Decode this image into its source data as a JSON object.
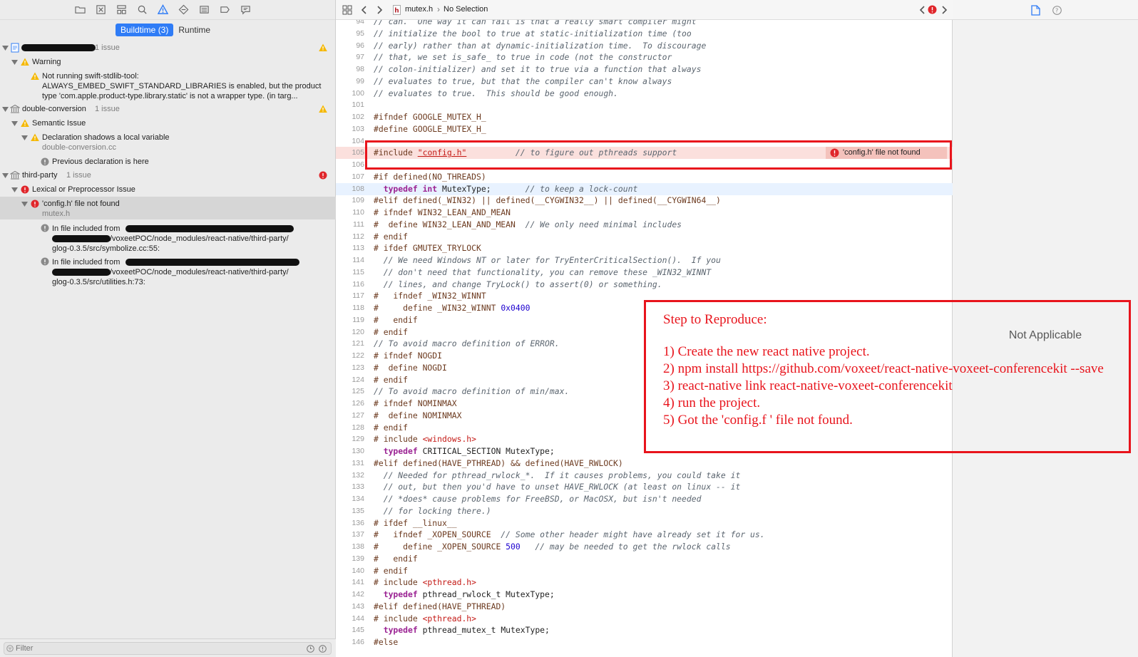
{
  "navigator": {
    "segments": {
      "buildtime": "Buildtime (3)",
      "runtime": "Runtime"
    },
    "issues": {
      "project_count": "1 issue",
      "warning_group": "Warning",
      "warning_text_1": "Not running swift-stdlib-tool:",
      "warning_text_2": "ALWAYS_EMBED_SWIFT_STANDARD_LIBRARIES is enabled, but the product",
      "warning_text_3": "type 'com.apple.product-type.library.static' is not a wrapper type. (in targ...",
      "dc_name": "double-conversion",
      "dc_count": "1 issue",
      "semantic_group": "Semantic Issue",
      "shadow_msg": "Declaration shadows a local variable",
      "shadow_file": "double-conversion.cc",
      "prev_decl": "Previous declaration is here",
      "tp_name": "third-party",
      "tp_count": "1 issue",
      "lex_group": "Lexical or Preprocessor Issue",
      "config_msg": "'config.h' file not found",
      "config_file": "mutex.h",
      "incl1_a": "In file included from",
      "incl1_b": "/voxeetPOC/node_modules/react-native/third-party/",
      "incl1_c": "glog-0.3.5/src/symbolize.cc:55:",
      "incl2_a": "In file included from",
      "incl2_b": "/voxeetPOC/node_modules/react-native/third-party/",
      "incl2_c": "glog-0.3.5/src/utilities.h:73:"
    },
    "filter_placeholder": "Filter"
  },
  "jump_bar": {
    "file": "mutex.h",
    "selection": "No Selection"
  },
  "editor": {
    "inline_error": "'config.h' file not found",
    "lines": [
      {
        "n": "94",
        "t": "// can.  One way it can fail is that a really smart compiler might",
        "k": "cm"
      },
      {
        "n": "95",
        "t": "// initialize the bool to true at static-initialization time (too",
        "k": "cm"
      },
      {
        "n": "96",
        "t": "// early) rather than at dynamic-initialization time.  To discourage",
        "k": "cm"
      },
      {
        "n": "97",
        "t": "// that, we set is_safe_ to true in code (not the constructor",
        "k": "cm"
      },
      {
        "n": "98",
        "t": "// colon-initializer) and set it to true via a function that always",
        "k": "cm"
      },
      {
        "n": "99",
        "t": "// evaluates to true, but that the compiler can't know always",
        "k": "cm"
      },
      {
        "n": "100",
        "t": "// evaluates to true.  This should be good enough.",
        "k": "cm"
      },
      {
        "n": "101",
        "t": "",
        "k": ""
      },
      {
        "n": "102",
        "t": "#ifndef GOOGLE_MUTEX_H_",
        "k": "pp"
      },
      {
        "n": "103",
        "t": "#define GOOGLE_MUTEX_H_",
        "k": "pp"
      },
      {
        "n": "104",
        "t": "",
        "k": ""
      },
      {
        "n": "105",
        "t": "",
        "k": "include"
      },
      {
        "n": "106",
        "t": "",
        "k": ""
      },
      {
        "n": "107",
        "t": "#if defined(NO_THREADS)",
        "k": "pp"
      },
      {
        "n": "108",
        "t": "",
        "k": "typedef108"
      },
      {
        "n": "109",
        "t": "#elif defined(_WIN32) || defined(__CYGWIN32__) || defined(__CYGWIN64__)",
        "k": "pp"
      },
      {
        "n": "110",
        "t": "# ifndef WIN32_LEAN_AND_MEAN",
        "k": "pp"
      },
      {
        "n": "111",
        "t": "",
        "k": "define111"
      },
      {
        "n": "112",
        "t": "# endif",
        "k": "pp"
      },
      {
        "n": "113",
        "t": "# ifdef GMUTEX_TRYLOCK",
        "k": "pp"
      },
      {
        "n": "114",
        "t": "  // We need Windows NT or later for TryEnterCriticalSection().  If you",
        "k": "cm"
      },
      {
        "n": "115",
        "t": "  // don't need that functionality, you can remove these _WIN32_WINNT",
        "k": "cm"
      },
      {
        "n": "116",
        "t": "  // lines, and change TryLock() to assert(0) or something.",
        "k": "cm"
      },
      {
        "n": "117",
        "t": "#   ifndef _WIN32_WINNT",
        "k": "pp"
      },
      {
        "n": "118",
        "t": "",
        "k": "define118"
      },
      {
        "n": "119",
        "t": "#   endif",
        "k": "pp"
      },
      {
        "n": "120",
        "t": "# endif",
        "k": "pp"
      },
      {
        "n": "121",
        "t": "// To avoid macro definition of ERROR.",
        "k": "cm"
      },
      {
        "n": "122",
        "t": "# ifndef NOGDI",
        "k": "pp"
      },
      {
        "n": "123",
        "t": "#  define NOGDI",
        "k": "pp"
      },
      {
        "n": "124",
        "t": "# endif",
        "k": "pp"
      },
      {
        "n": "125",
        "t": "// To avoid macro definition of min/max.",
        "k": "cm"
      },
      {
        "n": "126",
        "t": "# ifndef NOMINMAX",
        "k": "pp"
      },
      {
        "n": "127",
        "t": "#  define NOMINMAX",
        "k": "pp"
      },
      {
        "n": "128",
        "t": "# endif",
        "k": "pp"
      },
      {
        "n": "129",
        "t": "",
        "k": "incwin"
      },
      {
        "n": "130",
        "t": "",
        "k": "typedef130"
      },
      {
        "n": "131",
        "t": "#elif defined(HAVE_PTHREAD) && defined(HAVE_RWLOCK)",
        "k": "pp"
      },
      {
        "n": "132",
        "t": "  // Needed for pthread_rwlock_*.  If it causes problems, you could take it",
        "k": "cm"
      },
      {
        "n": "133",
        "t": "  // out, but then you'd have to unset HAVE_RWLOCK (at least on linux -- it",
        "k": "cm"
      },
      {
        "n": "134",
        "t": "  // *does* cause problems for FreeBSD, or MacOSX, but isn't needed",
        "k": "cm"
      },
      {
        "n": "135",
        "t": "  // for locking there.)",
        "k": "cm"
      },
      {
        "n": "136",
        "t": "# ifdef __linux__",
        "k": "pp"
      },
      {
        "n": "137",
        "t": "",
        "k": "ifndef137"
      },
      {
        "n": "138",
        "t": "",
        "k": "define138"
      },
      {
        "n": "139",
        "t": "#   endif",
        "k": "pp"
      },
      {
        "n": "140",
        "t": "# endif",
        "k": "pp"
      },
      {
        "n": "141",
        "t": "",
        "k": "incpth141"
      },
      {
        "n": "142",
        "t": "",
        "k": "typedef142"
      },
      {
        "n": "143",
        "t": "#elif defined(HAVE_PTHREAD)",
        "k": "pp"
      },
      {
        "n": "144",
        "t": "",
        "k": "incpth144"
      },
      {
        "n": "145",
        "t": "",
        "k": "typedef145"
      },
      {
        "n": "146",
        "t": "#else",
        "k": "pp"
      }
    ],
    "seg": {
      "inc_kw": "#include ",
      "inc_str": "\"config.h\"",
      "inc_cm": "          // to figure out pthreads support",
      "td108_kw": "  typedef int",
      "td108_rest": " MutexType;",
      "td108_cm": "       // to keep a lock-count",
      "d111_pp": "#  define WIN32_LEAN_AND_MEAN",
      "d111_cm": "  // We only need minimal includes",
      "d118_pp": "#     define _WIN32_WINNT ",
      "d118_num": "0x0400",
      "incwin_pp": "# include ",
      "incwin_str": "<windows.h>",
      "td130_kw": "  typedef",
      "td130_rest": " CRITICAL_SECTION MutexType;",
      "if137_pp": "#   ifndef _XOPEN_SOURCE",
      "if137_cm": "  // Some other header might have already set it for us.",
      "d138_pp": "#     define _XOPEN_SOURCE ",
      "d138_num": "500",
      "d138_cm": "   // may be needed to get the rwlock calls",
      "incpth_pp": "# include ",
      "incpth_str": "<pthread.h>",
      "td142_kw": "  typedef",
      "td142_rest": " pthread_rwlock_t MutexType;",
      "td145_kw": "  typedef",
      "td145_rest": " pthread_mutex_t MutexType;"
    }
  },
  "inspector": {
    "not_applicable": "Not Applicable"
  },
  "annotation": {
    "title": "Step to Reproduce:",
    "steps": [
      "1) Create the new react native project.",
      "2) npm install https://github.com/voxeet/react-native-voxeet-conferencekit --save",
      "3) react-native link react-native-voxeet-conferencekit",
      "4) run the project.",
      "5) Got the 'config.f ' file not found."
    ]
  },
  "colors": {
    "accent": "#2f7cf6",
    "error": "#e8141c",
    "warning": "#f5b800"
  }
}
